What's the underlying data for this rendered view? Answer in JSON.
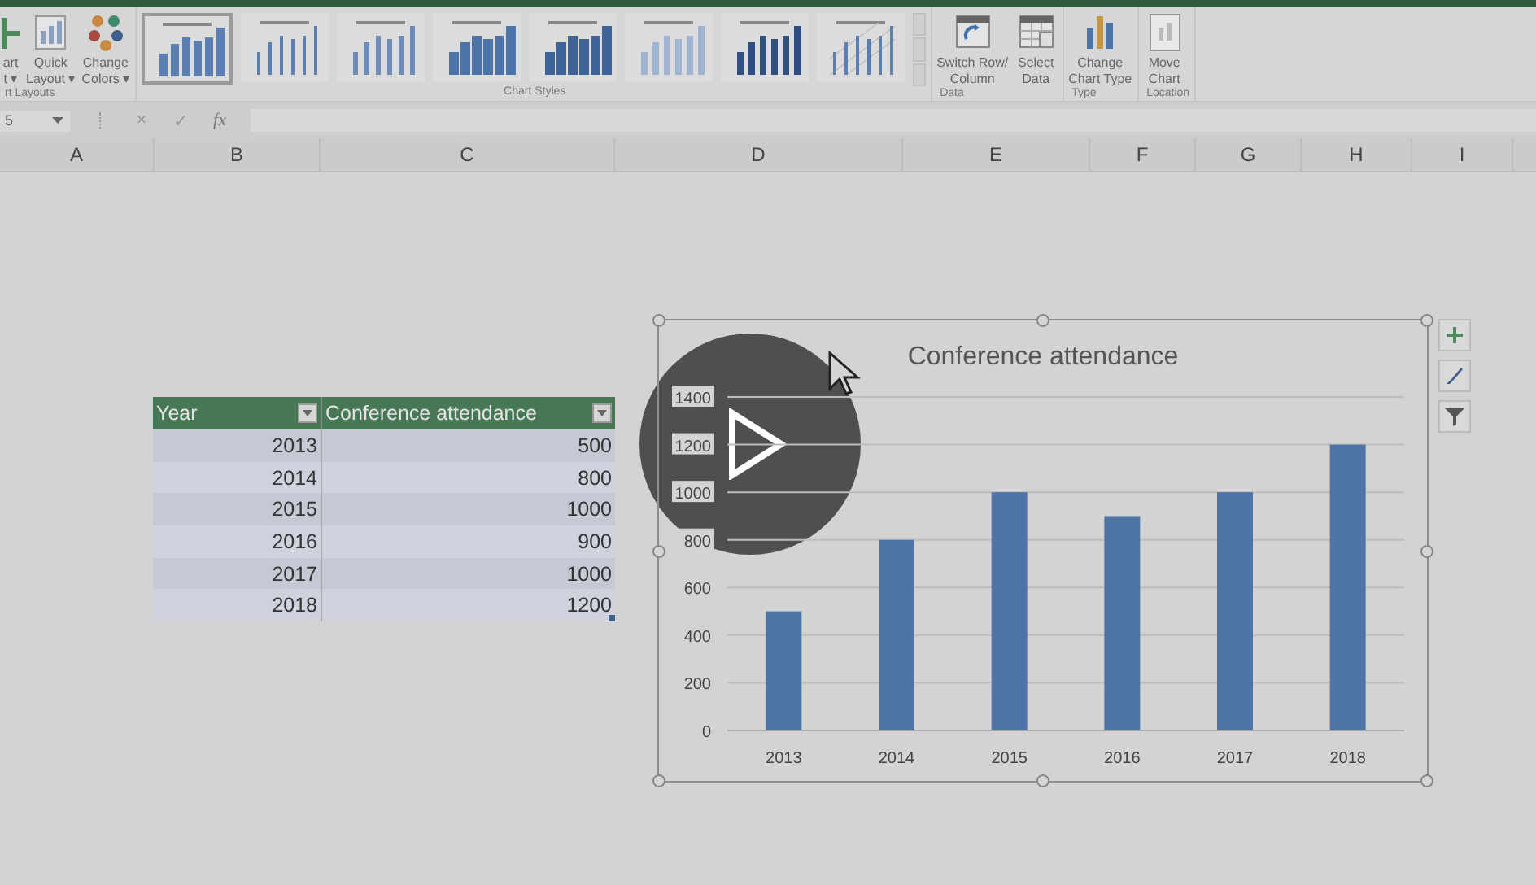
{
  "ribbon": {
    "groups": [
      {
        "kind": "buttons",
        "label": "rt Layouts",
        "buttons": [
          {
            "kind": "add",
            "lines": [
              "art",
              "t ▾"
            ]
          },
          {
            "kind": "layout",
            "lines": [
              "Quick",
              "Layout ▾"
            ]
          },
          {
            "kind": "colors",
            "lines": [
              "Change",
              "Colors ▾"
            ]
          }
        ]
      },
      {
        "kind": "gallery",
        "label": "Chart Styles",
        "styles": [
          {
            "kind": "solid",
            "selected": true
          },
          {
            "kind": "thin",
            "selected": false
          },
          {
            "kind": "dotted",
            "selected": false
          },
          {
            "kind": "bevel",
            "selected": false
          },
          {
            "kind": "shaded",
            "selected": false
          },
          {
            "kind": "fade",
            "selected": false
          },
          {
            "kind": "dark",
            "selected": false
          },
          {
            "kind": "hatched",
            "selected": false
          }
        ]
      },
      {
        "kind": "buttons",
        "label": "Data",
        "buttons": [
          {
            "kind": "switch",
            "lines": [
              "Switch Row/",
              "Column"
            ]
          },
          {
            "kind": "select",
            "lines": [
              "Select",
              "Data"
            ]
          }
        ]
      },
      {
        "kind": "buttons",
        "label": "Type",
        "buttons": [
          {
            "kind": "type",
            "lines": [
              "Change",
              "Chart Type"
            ]
          }
        ]
      },
      {
        "kind": "buttons",
        "label": "Location",
        "buttons": [
          {
            "kind": "move",
            "lines": [
              "Move",
              "Chart"
            ]
          }
        ]
      }
    ]
  },
  "formula_bar": {
    "name_box": "5",
    "cancel": "×",
    "enter": "✓",
    "function": "fx"
  },
  "columns": [
    "A",
    "B",
    "C",
    "D",
    "E",
    "F",
    "G",
    "H",
    "I"
  ],
  "table": {
    "columns": [
      "Year",
      "Conference attendance"
    ],
    "rows": [
      [
        "2013",
        "500"
      ],
      [
        "2014",
        "800"
      ],
      [
        "2015",
        "1000"
      ],
      [
        "2016",
        "900"
      ],
      [
        "2017",
        "1000"
      ],
      [
        "2018",
        "1200"
      ]
    ]
  },
  "chart": {
    "selected": true,
    "chart_data": {
      "type": "bar",
      "title": "Conference attendance",
      "categories": [
        "2013",
        "2014",
        "2015",
        "2016",
        "2017",
        "2018"
      ],
      "values": [
        500,
        800,
        1000,
        900,
        1000,
        1200
      ],
      "ylim": [
        0,
        1400
      ],
      "yticks": [
        0,
        200,
        400,
        600,
        800,
        1000,
        1200,
        1400
      ],
      "grid": true
    }
  }
}
